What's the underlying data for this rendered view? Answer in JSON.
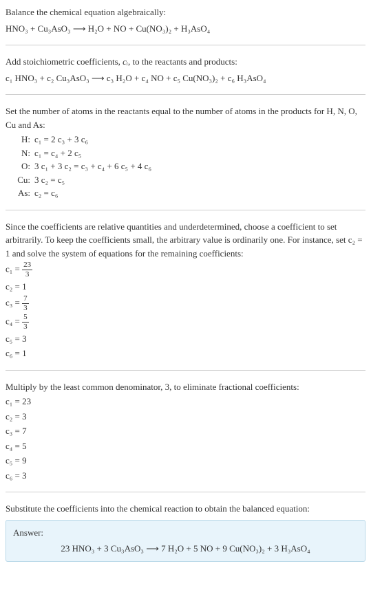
{
  "section1": {
    "title": "Balance the chemical equation algebraically:",
    "equation": "HNO₃ + Cu₃AsO₃  ⟶  H₂O + NO + Cu(NO₃)₂ + H₃AsO₄"
  },
  "section2": {
    "title_a": "Add stoichiometric coefficients, ",
    "ci": "cᵢ",
    "title_b": ", to the reactants and products:",
    "equation": "c₁ HNO₃ + c₂ Cu₃AsO₃  ⟶  c₃ H₂O + c₄ NO + c₅ Cu(NO₃)₂ + c₆ H₃AsO₄"
  },
  "section3": {
    "title": "Set the number of atoms in the reactants equal to the number of atoms in the products for H, N, O, Cu and As:",
    "atoms": {
      "h_label": "H:",
      "h_eq": "c₁ = 2 c₃ + 3 c₆",
      "n_label": "N:",
      "n_eq": "c₁ = c₄ + 2 c₅",
      "o_label": "O:",
      "o_eq": "3 c₁ + 3 c₂ = c₃ + c₄ + 6 c₅ + 4 c₆",
      "cu_label": "Cu:",
      "cu_eq": "3 c₂ = c₅",
      "as_label": "As:",
      "as_eq": "c₂ = c₆"
    }
  },
  "section4": {
    "title": "Since the coefficients are relative quantities and underdetermined, choose a coefficient to set arbitrarily. To keep the coefficients small, the arbitrary value is ordinarily one. For instance, set c₂ = 1 and solve the system of equations for the remaining coefficients:",
    "coeffs": {
      "c1_l": "c₁ = ",
      "c1_num": "23",
      "c1_den": "3",
      "c2": "c₂ = 1",
      "c3_l": "c₃ = ",
      "c3_num": "7",
      "c3_den": "3",
      "c4_l": "c₄ = ",
      "c4_num": "5",
      "c4_den": "3",
      "c5": "c₅ = 3",
      "c6": "c₆ = 1"
    }
  },
  "section5": {
    "title": "Multiply by the least common denominator, 3, to eliminate fractional coefficients:",
    "coeffs": {
      "c1": "c₁ = 23",
      "c2": "c₂ = 3",
      "c3": "c₃ = 7",
      "c4": "c₄ = 5",
      "c5": "c₅ = 9",
      "c6": "c₆ = 3"
    }
  },
  "section6": {
    "title": "Substitute the coefficients into the chemical reaction to obtain the balanced equation:",
    "answer_label": "Answer:",
    "answer_eq": "23 HNO₃ + 3 Cu₃AsO₃  ⟶  7 H₂O + 5 NO + 9 Cu(NO₃)₂ + 3 H₃AsO₄"
  }
}
